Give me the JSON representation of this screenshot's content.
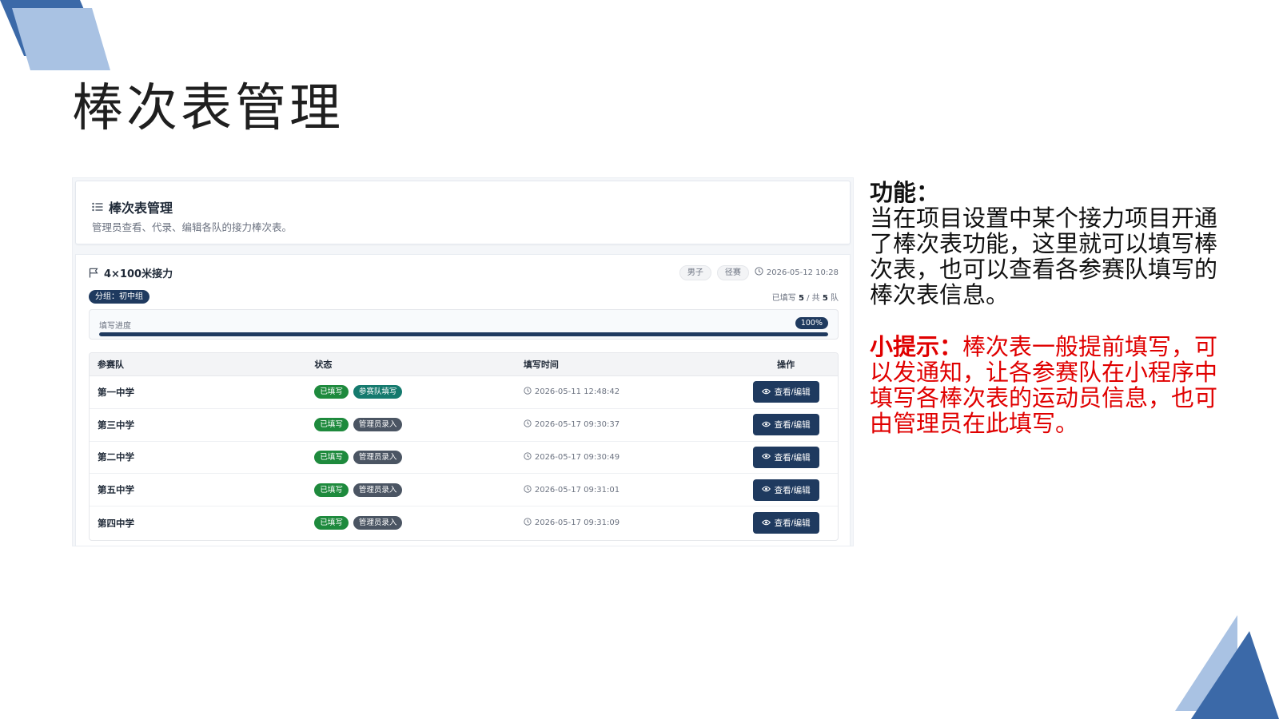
{
  "slide": {
    "title": "棒次表管理"
  },
  "header": {
    "title": "棒次表管理",
    "subtitle": "管理员查看、代录、编辑各队的接力棒次表。"
  },
  "event": {
    "name": "4×100米接力",
    "chips": [
      "男子",
      "径赛"
    ],
    "time": "2026-05-12 10:28",
    "group": "分组：初中组",
    "filled_prefix": "已填写",
    "filled_count": "5",
    "filled_mid": "/ 共",
    "total_count": "5",
    "filled_suffix": "队"
  },
  "progress": {
    "label": "填写进度",
    "percent_text": "100%",
    "value": 1.0
  },
  "table": {
    "headers": [
      "参赛队",
      "状态",
      "填写时间",
      "操作"
    ],
    "rows": [
      {
        "team": "第一中学",
        "status": "已填写",
        "source": "参赛队填写",
        "time": "2026-05-11 12:48:42",
        "action": "查看/编辑"
      },
      {
        "team": "第三中学",
        "status": "已填写",
        "source": "管理员录入",
        "time": "2026-05-17 09:30:37",
        "action": "查看/编辑"
      },
      {
        "team": "第二中学",
        "status": "已填写",
        "source": "管理员录入",
        "time": "2026-05-17 09:30:49",
        "action": "查看/编辑"
      },
      {
        "team": "第五中学",
        "status": "已填写",
        "source": "管理员录入",
        "time": "2026-05-17 09:31:01",
        "action": "查看/编辑"
      },
      {
        "team": "第四中学",
        "status": "已填写",
        "source": "管理员录入",
        "time": "2026-05-17 09:31:09",
        "action": "查看/编辑"
      }
    ]
  },
  "notes": {
    "function_label": "功能：",
    "function_text": "当在项目设置中某个接力项目开通了棒次表功能，这里就可以填写棒次表，也可以查看各参赛队填写的棒次表信息。",
    "tip_label": "小提示：",
    "tip_text": "棒次表一般提前填写，可以发通知，让各参赛队在小程序中填写各棒次表的运动员信息，也可由管理员在此填写。"
  },
  "colors": {
    "navy": "#1f3a5f",
    "green": "#1e8a3d",
    "teal": "#157a6e",
    "tip_red": "#e00000",
    "deco_dark": "#3b69a8",
    "deco_light": "#a9c2e3"
  },
  "icons": [
    "list-icon",
    "flag-icon",
    "clock-icon",
    "eye-icon"
  ]
}
